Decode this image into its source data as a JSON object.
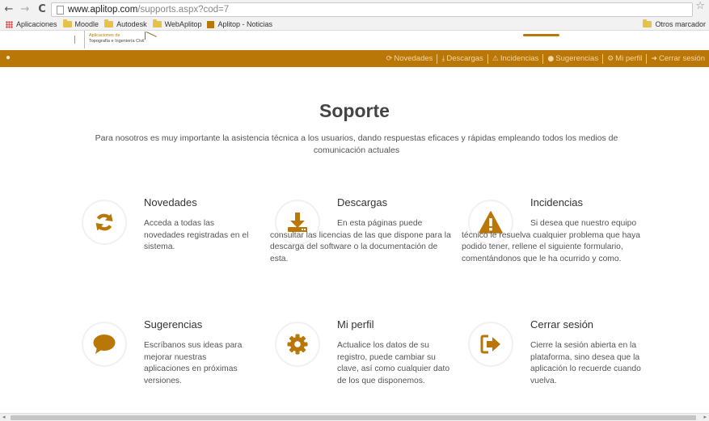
{
  "browser": {
    "url_host": "www.aplitop.com",
    "url_path": "/supports.aspx?cod=7",
    "bookmarks": [
      {
        "label": "Aplicaciones",
        "icon": "apps-grid-icon"
      },
      {
        "label": "Moodle",
        "icon": "folder-icon"
      },
      {
        "label": "Autodesk",
        "icon": "folder-icon"
      },
      {
        "label": "WebAplitop",
        "icon": "folder-icon"
      },
      {
        "label": "Aplitop - Noticias",
        "icon": "aplitop-icon"
      }
    ],
    "other_bookmarks": "Otros marcador"
  },
  "logo": {
    "line1": "Aplicaciones de",
    "line2": "Topografía e Ingeniería Civil"
  },
  "nav": {
    "accent_color": "#b97707",
    "links": [
      {
        "label": "Novedades",
        "icon": "refresh-icon"
      },
      {
        "label": "Descargas",
        "icon": "download-icon"
      },
      {
        "label": "Incidencias",
        "icon": "warning-icon"
      },
      {
        "label": "Sugerencias",
        "icon": "comment-icon"
      },
      {
        "label": "Mi perfil",
        "icon": "gear-icon"
      },
      {
        "label": "Cerrar sesión",
        "icon": "sign-out-icon"
      }
    ]
  },
  "main": {
    "title": "Soporte",
    "intro": "Para nosotros es muy importante la asistencia técnica a los usuarios, dando respuestas eficaces y rápidas empleando todos los medios de comunicación actuales",
    "features": [
      {
        "title": "Novedades",
        "description": "Acceda a todas las novedades registradas en el sistema.",
        "icon": "refresh-icon"
      },
      {
        "title": "Descargas",
        "description": "En esta páginas puede consultar las licencias de las que dispone para la descarga del software o la documentación de esta.",
        "icon": "download-icon"
      },
      {
        "title": "Incidencias",
        "description": "Si desea que nuestro equipo técnico le resuelva cualquier problema que haya podido tener, rellene el siguiente formulario, comentándonos que le ha ocurrido y como.",
        "icon": "warning-icon"
      },
      {
        "title": "Sugerencias",
        "description": "Escríbanos sus ideas para mejorar nuestras aplicaciones en próximas versiones.",
        "icon": "comment-icon"
      },
      {
        "title": "Mi perfil",
        "description": "Actualice los datos de su registro, puede cambiar su clave, así como cualquier dato de los que disponemos.",
        "icon": "gear-icon"
      },
      {
        "title": "Cerrar sesión",
        "description": "Cierre la sesión abierta en la plataforma, sino desea que la aplicación lo recuerde cuando vuelva.",
        "icon": "sign-out-icon"
      }
    ]
  }
}
